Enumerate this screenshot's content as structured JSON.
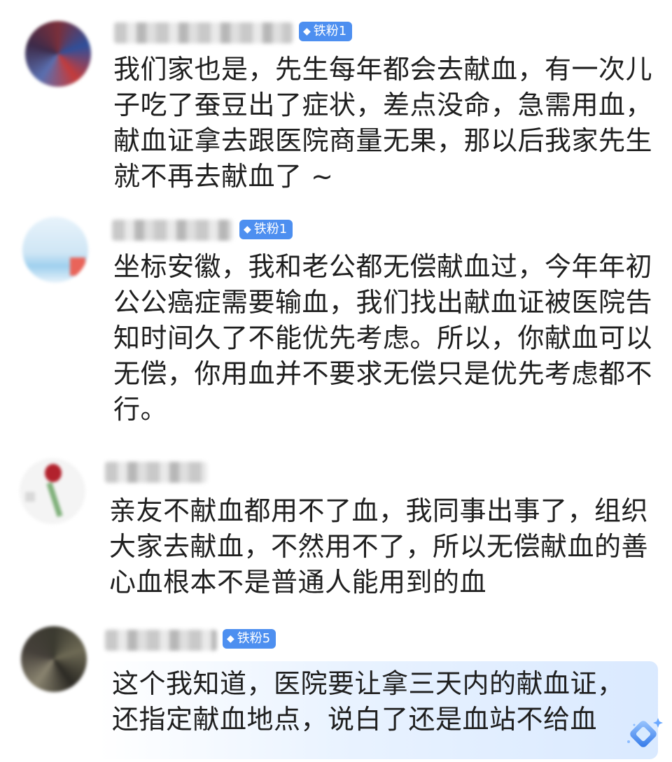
{
  "comments": [
    {
      "badge": "铁粉1",
      "lines": [
        "我们家也是，先生每年都会去献血，有一次儿",
        "子吃了蚕豆出了症状，差点没命，急需用血，",
        "献血证拿去跟医院商量无果，那以后我家先生",
        "就不再去献血了 ~"
      ]
    },
    {
      "badge": "铁粉1",
      "lines": [
        "坐标安徽，我和老公都无偿献血过，今年年初",
        "公公癌症需要输血，我们找出献血证被医院告",
        "知时间久了不能优先考虑。所以，你献血可以",
        "无偿，你用血并不要求无偿只是优先考虑都不",
        "行。"
      ]
    },
    {
      "badge": "",
      "lines": [
        "亲友不献血都用不了血，我同事出事了，组织",
        "大家去献血，不然用不了，所以无偿献血的善",
        "心血根本不是普通人能用到的血"
      ]
    },
    {
      "badge": "铁粉5",
      "lines": [
        "这个我知道，医院要让拿三天内的献血证，",
        "还指定献血地点，说白了还是血站不给血"
      ]
    }
  ],
  "icons": {
    "badge": "diamond-icon",
    "corner": "sparkle-diamond-icon"
  },
  "colors": {
    "badge": "#4d8ff0",
    "highlight": "#d6e8ff"
  }
}
